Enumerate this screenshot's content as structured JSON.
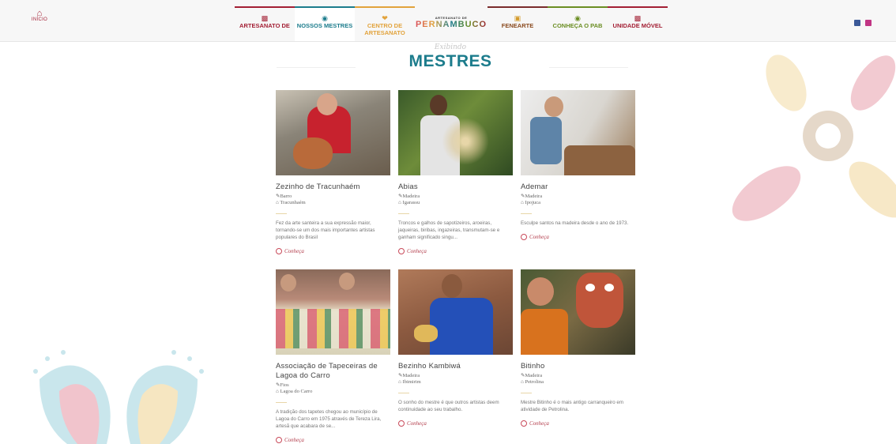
{
  "nav": {
    "home": {
      "icon": "home-icon",
      "label": "INÍCIO"
    },
    "items": [
      {
        "label": "ARTESANATO DE",
        "icon": "artesanato-icon",
        "color": "#a31f34",
        "accent": "#a31f34"
      },
      {
        "label": "NOSSOS MESTRES",
        "icon": "mestres-icon",
        "color": "#1c7c8c",
        "accent": "#1c7c8c"
      },
      {
        "label": "CENTRO DE ARTESANATO",
        "icon": "centro-icon",
        "color": "#e2a33c",
        "accent": "#e2a33c"
      },
      {
        "logo": true,
        "small": "ARTESANATO DE",
        "big": "PERNAMBUCO"
      },
      {
        "label": "FENEARTE",
        "icon": "fenearte-icon",
        "color": "#8a4a1e",
        "accent": "#7a2c2c"
      },
      {
        "label": "CONHEÇA O PAB",
        "icon": "pab-icon",
        "color": "#6b8e23",
        "accent": "#6b8e23"
      },
      {
        "label": "UNIDADE MÓVEL",
        "icon": "unidade-movel-icon",
        "color": "#a31f34",
        "accent": "#a31f34"
      }
    ],
    "social": [
      {
        "icon": "facebook-icon",
        "color": "#3b5998"
      },
      {
        "icon": "instagram-icon",
        "color": "#c13584"
      }
    ]
  },
  "page": {
    "exhibit": "Exibindo",
    "title": "MESTRES"
  },
  "masters": [
    {
      "name": "Zezinho de Tracunhaém",
      "material": "Barro",
      "city": "Tracunhaém",
      "desc": "Fez da arte santeira a sua expressão maior, tornando-se um dos mais importantes artistas populares do Brasil",
      "cta": "Conheça",
      "photo": "zezinho"
    },
    {
      "name": "Abias",
      "material": "Madeira",
      "city": "Igarassu",
      "desc": "Troncos e galhos de sapotizeiros, aroeiras, jaqueiras, biribas, ingazeiras, transmutam-se e ganham significado singu...",
      "cta": "Conheça",
      "photo": "abias"
    },
    {
      "name": "Ademar",
      "material": "Madeira",
      "city": "Ipojuca",
      "desc": "Esculpe santos na madeira desde o ano de 1973.",
      "cta": "Conheça",
      "photo": "ademar"
    },
    {
      "name": "Associação de Tapeceiras de Lagoa do Carro",
      "material": "Fios",
      "city": "Lagoa do Carro",
      "desc": "A tradição dos tapetes chegou ao município de Lagoa do Carro em 1975 através de Tereza Lira, artesã que acabara de se...",
      "cta": "Conheça",
      "photo": "tapeceiras"
    },
    {
      "name": "Bezinho Kambiwá",
      "material": "Madeira",
      "city": "Ibimirim",
      "desc": "O sonho do mestre é que outros artistas deem continuidade ao seu trabalho.",
      "cta": "Conheça",
      "photo": "bezinho"
    },
    {
      "name": "Bitinho",
      "material": "Madeira",
      "city": "Petrolina",
      "desc": "Mestre Bitinho é o mais antigo carranqueiro em atividade de Petrolina.",
      "cta": "Conheça",
      "photo": "bitinho"
    }
  ]
}
